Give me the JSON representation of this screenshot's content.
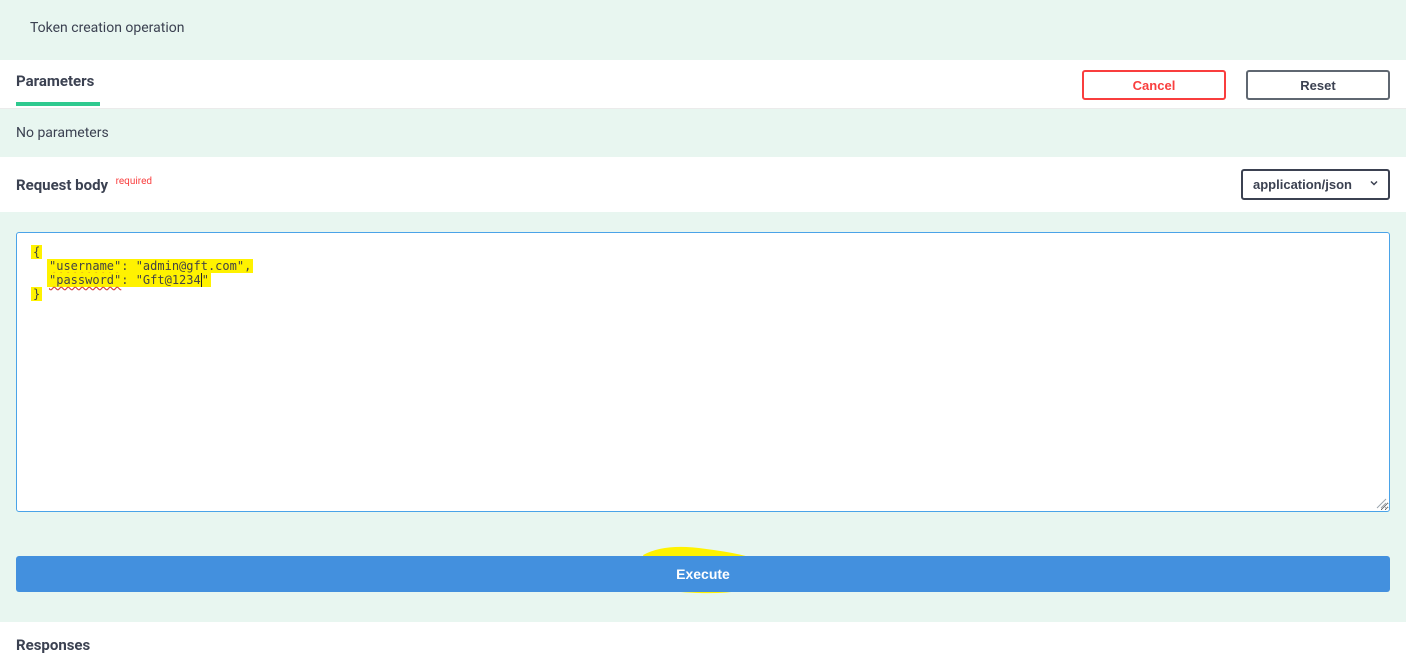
{
  "operation": {
    "description": "Token creation operation"
  },
  "sections": {
    "parameters_title": "Parameters",
    "no_params_text": "No parameters",
    "request_body_title": "Request body",
    "required_label": "required",
    "responses_title": "Responses"
  },
  "buttons": {
    "cancel": "Cancel",
    "reset": "Reset",
    "execute": "Execute"
  },
  "content_type": {
    "selected": "application/json",
    "options": [
      "application/json"
    ]
  },
  "request_body": {
    "open": "{",
    "close": "}",
    "line1_key": "\"username\"",
    "line1_val": ": \"admin@gft.com\",",
    "line2_key": "\"password\"",
    "line2_val_a": ": \"Gft@1234",
    "line2_val_b": "\""
  },
  "colors": {
    "bg_mint": "#e8f6f0",
    "accent_green": "#2fc98f",
    "execute_blue": "#4390de",
    "cancel_red": "#f93e3e",
    "highlight": "#fff200"
  }
}
